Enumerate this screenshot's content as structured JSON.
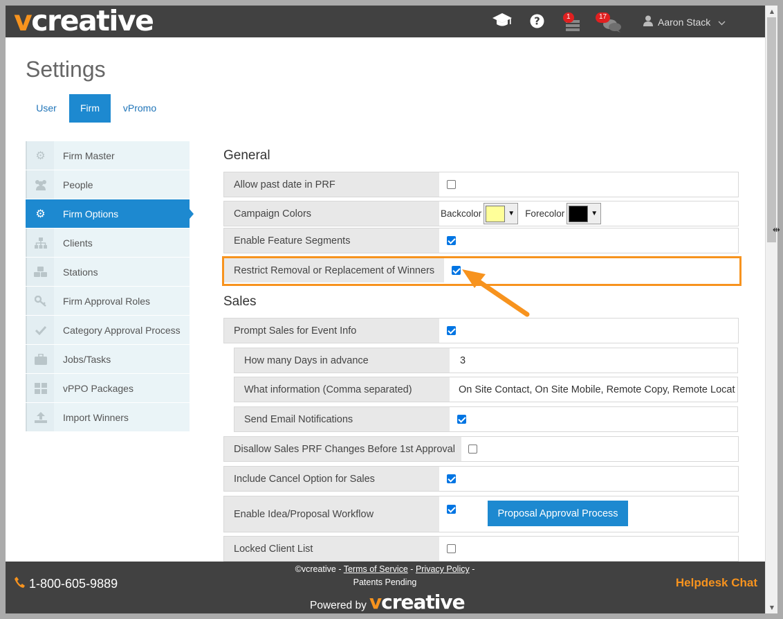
{
  "brand": {
    "logo_v": "v",
    "logo_rest": "creative"
  },
  "header": {
    "notifications_badge": "1",
    "messages_badge": "17",
    "user_name": "Aaron Stack"
  },
  "page_title": "Settings",
  "tabs": [
    {
      "label": "User",
      "active": false
    },
    {
      "label": "Firm",
      "active": true
    },
    {
      "label": "vPromo",
      "active": false
    }
  ],
  "sidebar": {
    "items": [
      {
        "label": "Firm Master",
        "icon": "gear-icon"
      },
      {
        "label": "People",
        "icon": "people-icon"
      },
      {
        "label": "Firm Options",
        "icon": "gear-icon",
        "active": true
      },
      {
        "label": "Clients",
        "icon": "sitemap-icon"
      },
      {
        "label": "Stations",
        "icon": "cubes-icon"
      },
      {
        "label": "Firm Approval Roles",
        "icon": "key-icon"
      },
      {
        "label": "Category Approval Process",
        "icon": "check-icon"
      },
      {
        "label": "Jobs/Tasks",
        "icon": "briefcase-icon"
      },
      {
        "label": "vPPO Packages",
        "icon": "grid-icon"
      },
      {
        "label": "Import Winners",
        "icon": "upload-icon"
      }
    ]
  },
  "general": {
    "title": "General",
    "allow_past_date": {
      "label": "Allow past date in PRF",
      "checked": false
    },
    "campaign_colors": {
      "label": "Campaign Colors",
      "backcolor_label": "Backcolor",
      "backcolor_value": "#ffff99",
      "forecolor_label": "Forecolor",
      "forecolor_value": "#000000"
    },
    "enable_feature_segments": {
      "label": "Enable Feature Segments",
      "checked": true
    },
    "restrict_removal": {
      "label": "Restrict Removal or Replacement of Winners",
      "checked": true
    }
  },
  "sales": {
    "title": "Sales",
    "prompt_sales": {
      "label": "Prompt Sales for Event Info",
      "checked": true
    },
    "days_in_advance": {
      "label": "How many Days in advance",
      "value": "3"
    },
    "what_information": {
      "label": "What information (Comma separated)",
      "value": "On Site Contact, On Site Mobile, Remote Copy, Remote Locat"
    },
    "send_email": {
      "label": "Send Email Notifications",
      "checked": true
    },
    "disallow_changes": {
      "label": "Disallow Sales PRF Changes Before 1st Approval",
      "checked": false
    },
    "include_cancel": {
      "label": "Include Cancel Option for Sales",
      "checked": true
    },
    "idea_workflow": {
      "label": "Enable Idea/Proposal Workflow",
      "checked": true,
      "button_label": "Proposal Approval Process"
    },
    "locked_client_list": {
      "label": "Locked Client List",
      "checked": false
    }
  },
  "footer": {
    "phone": "1-800-605-9889",
    "copyright": "©vcreative",
    "sep1": " - ",
    "terms": "Terms of Service",
    "sep2": " - ",
    "privacy": "Privacy Policy",
    "patents": " - Patents Pending",
    "powered_by": "Powered by",
    "helpdesk": "Helpdesk Chat"
  },
  "colors": {
    "accent": "#f7931e",
    "primary": "#1d89d0",
    "header_bg": "#414141"
  }
}
